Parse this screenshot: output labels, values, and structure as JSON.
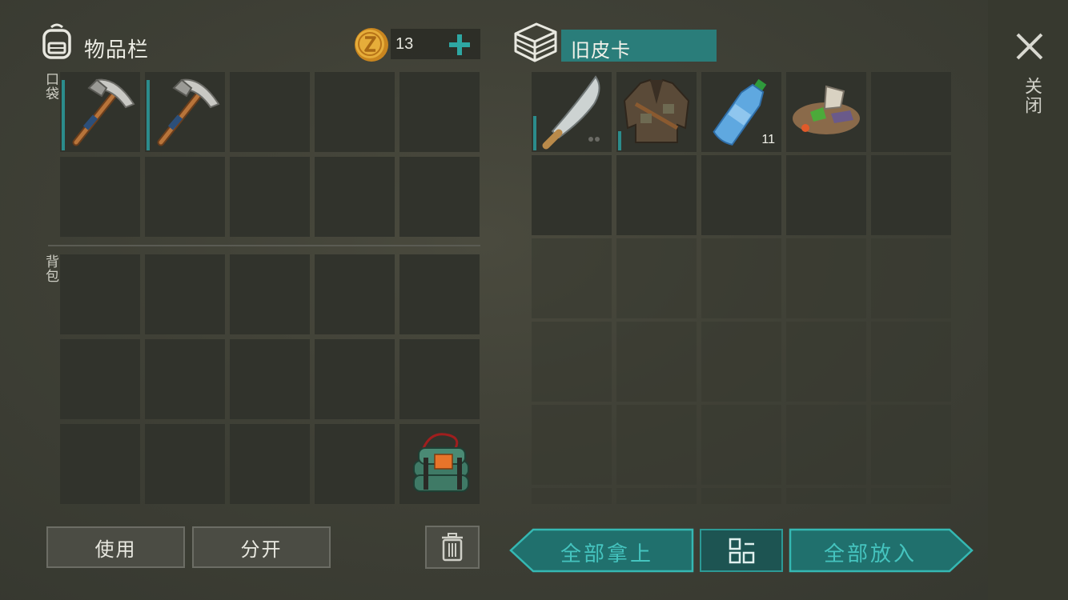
{
  "inventory": {
    "title": "物品栏",
    "icon": "backpack-icon",
    "coins": "13",
    "add_coin_icon": "plus-icon",
    "pocket_label": "口袋",
    "backpack_label": "背包"
  },
  "container": {
    "name": "旧皮卡",
    "icon": "crate-icon",
    "items": [
      {
        "name": "machete-icon",
        "durability": 0.45
      },
      {
        "name": "jacket-icon",
        "durability": 0.25
      },
      {
        "name": "water-bottle-icon",
        "qty": "11"
      },
      {
        "name": "scrap-pile-icon"
      }
    ]
  },
  "pocket_items": [
    {
      "name": "pickaxe-icon",
      "durability": 0.92
    },
    {
      "name": "pickaxe-icon",
      "durability": 0.92
    }
  ],
  "backpack_items": [
    {
      "name": "explosive-icon"
    }
  ],
  "buttons": {
    "use": "使用",
    "split": "分开",
    "trash_icon": "trash-icon",
    "take_all": "全部拿上",
    "sort_icon": "grid-icon",
    "put_all": "全部放入"
  },
  "close": {
    "icon": "close-icon",
    "label": "关闭"
  },
  "colors": {
    "accent": "#2a9a98",
    "button_teal": "#1f6e6c",
    "coin": "#d99a2b"
  }
}
